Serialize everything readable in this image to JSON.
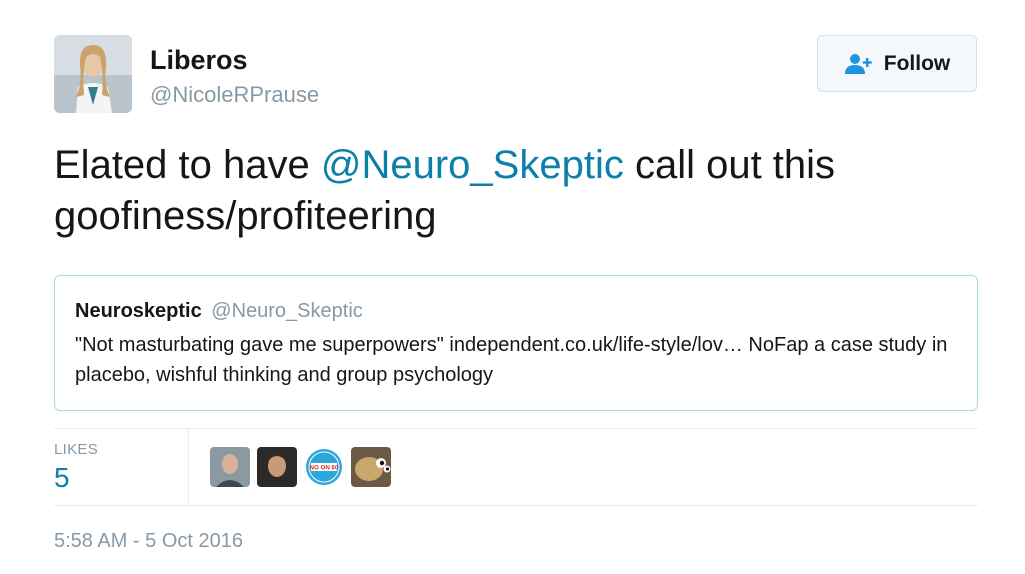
{
  "author": {
    "display_name": "Liberos",
    "handle": "@NicoleRPrause"
  },
  "follow_button": {
    "label": "Follow",
    "icon": "follow-user-plus-icon"
  },
  "tweet": {
    "text_before": "Elated to have ",
    "mention": "@Neuro_Skeptic",
    "text_after": " call out this goofiness/profiteering"
  },
  "quoted_tweet": {
    "display_name": "Neuroskeptic",
    "handle": "@Neuro_Skeptic",
    "text": "\"Not masturbating gave me superpowers\" independent.co.uk/life-style/lov… NoFap a case study in placebo, wishful thinking and group psychology"
  },
  "stats": {
    "likes_label": "LIKES",
    "likes_count": "5",
    "liker_avatars": [
      "liker-avatar-1",
      "liker-avatar-2",
      "liker-avatar-3",
      "liker-avatar-4"
    ],
    "badge_text": [
      "NO ON 60"
    ]
  },
  "timestamp": "5:58 AM - 5 Oct 2016",
  "colors": {
    "link": "#0e7fa8",
    "secondary_text": "#8899a6",
    "quote_border": "#a9d7dc",
    "follow_icon": "#1b95e0"
  }
}
